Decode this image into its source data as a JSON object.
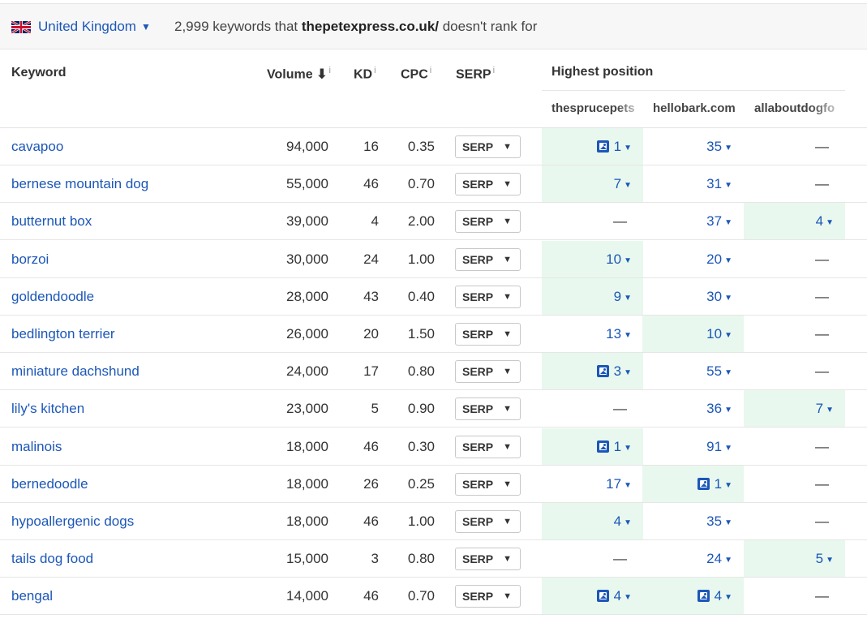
{
  "topbar": {
    "country": "United Kingdom",
    "count": "2,999",
    "text_keywords_that": " keywords that ",
    "domain": "thepetexpress.co.uk/",
    "text_rank": " doesn't rank for"
  },
  "headers": {
    "keyword": "Keyword",
    "volume": "Volume",
    "kd": "KD",
    "cpc": "CPC",
    "serp": "SERP",
    "info": "i",
    "highest_position": "Highest position",
    "competitors": [
      "thesprucepets",
      "hellobark.com",
      "allaboutdogfo"
    ]
  },
  "serp_label": "SERP",
  "dash": "—",
  "rows": [
    {
      "keyword": "cavapoo",
      "volume": "94,000",
      "kd": "16",
      "cpc": "0.35",
      "pos": [
        {
          "v": "1",
          "img": true,
          "hl": true
        },
        {
          "v": "35",
          "img": false,
          "hl": false
        },
        {
          "v": "",
          "img": false,
          "hl": false
        }
      ]
    },
    {
      "keyword": "bernese mountain dog",
      "volume": "55,000",
      "kd": "46",
      "cpc": "0.70",
      "pos": [
        {
          "v": "7",
          "img": false,
          "hl": true
        },
        {
          "v": "31",
          "img": false,
          "hl": false
        },
        {
          "v": "",
          "img": false,
          "hl": false
        }
      ]
    },
    {
      "keyword": "butternut box",
      "volume": "39,000",
      "kd": "4",
      "cpc": "2.00",
      "pos": [
        {
          "v": "",
          "img": false,
          "hl": false
        },
        {
          "v": "37",
          "img": false,
          "hl": false
        },
        {
          "v": "4",
          "img": false,
          "hl": true
        }
      ]
    },
    {
      "keyword": "borzoi",
      "volume": "30,000",
      "kd": "24",
      "cpc": "1.00",
      "pos": [
        {
          "v": "10",
          "img": false,
          "hl": true
        },
        {
          "v": "20",
          "img": false,
          "hl": false
        },
        {
          "v": "",
          "img": false,
          "hl": false
        }
      ]
    },
    {
      "keyword": "goldendoodle",
      "volume": "28,000",
      "kd": "43",
      "cpc": "0.40",
      "pos": [
        {
          "v": "9",
          "img": false,
          "hl": true
        },
        {
          "v": "30",
          "img": false,
          "hl": false
        },
        {
          "v": "",
          "img": false,
          "hl": false
        }
      ]
    },
    {
      "keyword": "bedlington terrier",
      "volume": "26,000",
      "kd": "20",
      "cpc": "1.50",
      "pos": [
        {
          "v": "13",
          "img": false,
          "hl": false
        },
        {
          "v": "10",
          "img": false,
          "hl": true
        },
        {
          "v": "",
          "img": false,
          "hl": false
        }
      ]
    },
    {
      "keyword": "miniature dachshund",
      "volume": "24,000",
      "kd": "17",
      "cpc": "0.80",
      "pos": [
        {
          "v": "3",
          "img": true,
          "hl": true
        },
        {
          "v": "55",
          "img": false,
          "hl": false
        },
        {
          "v": "",
          "img": false,
          "hl": false
        }
      ]
    },
    {
      "keyword": "lily's kitchen",
      "volume": "23,000",
      "kd": "5",
      "cpc": "0.90",
      "pos": [
        {
          "v": "",
          "img": false,
          "hl": false
        },
        {
          "v": "36",
          "img": false,
          "hl": false
        },
        {
          "v": "7",
          "img": false,
          "hl": true
        }
      ]
    },
    {
      "keyword": "malinois",
      "volume": "18,000",
      "kd": "46",
      "cpc": "0.30",
      "pos": [
        {
          "v": "1",
          "img": true,
          "hl": true
        },
        {
          "v": "91",
          "img": false,
          "hl": false
        },
        {
          "v": "",
          "img": false,
          "hl": false
        }
      ]
    },
    {
      "keyword": "bernedoodle",
      "volume": "18,000",
      "kd": "26",
      "cpc": "0.25",
      "pos": [
        {
          "v": "17",
          "img": false,
          "hl": false
        },
        {
          "v": "1",
          "img": true,
          "hl": true
        },
        {
          "v": "",
          "img": false,
          "hl": false
        }
      ]
    },
    {
      "keyword": "hypoallergenic dogs",
      "volume": "18,000",
      "kd": "46",
      "cpc": "1.00",
      "pos": [
        {
          "v": "4",
          "img": false,
          "hl": true
        },
        {
          "v": "35",
          "img": false,
          "hl": false
        },
        {
          "v": "",
          "img": false,
          "hl": false
        }
      ]
    },
    {
      "keyword": "tails dog food",
      "volume": "15,000",
      "kd": "3",
      "cpc": "0.80",
      "pos": [
        {
          "v": "",
          "img": false,
          "hl": false
        },
        {
          "v": "24",
          "img": false,
          "hl": false
        },
        {
          "v": "5",
          "img": false,
          "hl": true
        }
      ]
    },
    {
      "keyword": "bengal",
      "volume": "14,000",
      "kd": "46",
      "cpc": "0.70",
      "pos": [
        {
          "v": "4",
          "img": true,
          "hl": true
        },
        {
          "v": "4",
          "img": true,
          "hl": true
        },
        {
          "v": "",
          "img": false,
          "hl": false
        }
      ]
    }
  ]
}
